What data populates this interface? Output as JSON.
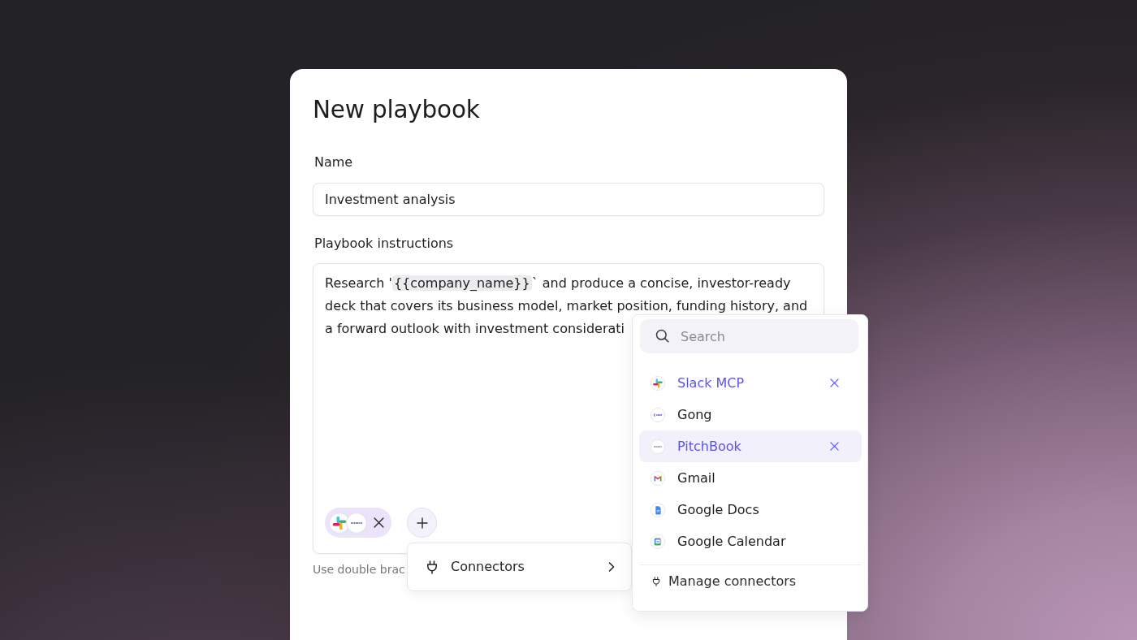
{
  "dialog": {
    "title": "New playbook"
  },
  "name_field": {
    "label": "Name",
    "value": "Investment analysis"
  },
  "instructions_field": {
    "label": "Playbook instructions",
    "lines": [
      [
        {
          "kind": "plain",
          "text": "Research '"
        },
        {
          "kind": "variable",
          "text": "{{company_name}}"
        },
        {
          "kind": "plain",
          "text": "` and produce a concise, investor-ready"
        }
      ],
      [
        {
          "kind": "plain",
          "text": "deck that covers its business model, market position, funding history, and"
        }
      ],
      [
        {
          "kind": "plain",
          "text": "a forward outlook with investment considerati"
        }
      ]
    ],
    "hint": "Use double brac"
  },
  "add_menu": {
    "items": [
      {
        "label": "Connectors"
      }
    ]
  },
  "connectors_popover": {
    "search": {
      "placeholder": "Search"
    },
    "items": [
      {
        "label": "Slack MCP",
        "kind": "slack",
        "selected": true,
        "highlighted": false
      },
      {
        "label": "Gong",
        "kind": "gong",
        "selected": false,
        "highlighted": false
      },
      {
        "label": "PitchBook",
        "kind": "pitchbook",
        "selected": true,
        "highlighted": true
      },
      {
        "label": "Gmail",
        "kind": "gmail",
        "selected": false,
        "highlighted": false
      },
      {
        "label": "Google Docs",
        "kind": "docs",
        "selected": false,
        "highlighted": false
      },
      {
        "label": "Google Calendar",
        "kind": "calendar",
        "selected": false,
        "highlighted": false
      }
    ],
    "footer": {
      "label": "Manage connectors"
    }
  }
}
